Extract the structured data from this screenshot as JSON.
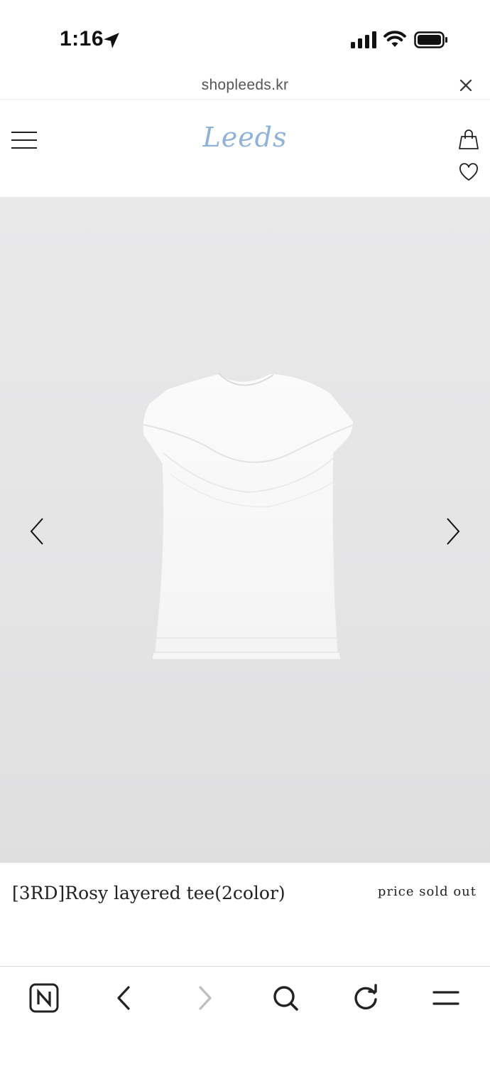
{
  "status_bar": {
    "time": "1:16"
  },
  "url_bar": {
    "url": "shopleeds.kr",
    "close_icon": "close-icon"
  },
  "header": {
    "logo": "Leeds",
    "logo_color": "#8fb3d8",
    "menu_icon": "hamburger-menu-icon",
    "cart_icon": "shopping-bag-icon",
    "wishlist_icon": "heart-icon"
  },
  "product": {
    "name": "[3RD]Rosy layered tee(2color)",
    "price_status": "price sold out",
    "image_description_icon": "white-draped-tee-photo",
    "prev_icon": "chevron-left-icon",
    "next_icon": "chevron-right-icon"
  },
  "toolbar": {
    "items": [
      {
        "icon": "naver-n-icon"
      },
      {
        "icon": "back-arrow-icon"
      },
      {
        "icon": "forward-arrow-icon"
      },
      {
        "icon": "search-icon"
      },
      {
        "icon": "refresh-icon"
      },
      {
        "icon": "menu-icon"
      }
    ]
  }
}
